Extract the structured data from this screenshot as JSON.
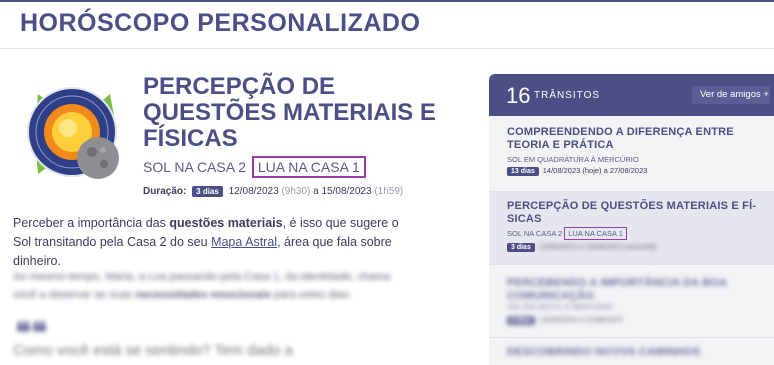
{
  "header": {
    "title": "HORÓSCOPO PERSONALIZADO"
  },
  "article": {
    "title": "PERCEPÇÃO DE QUESTÕES MATERIAIS E FÍSICAS",
    "subtitle_sun": "SOL NA CASA 2",
    "subtitle_moon": "LUA NA CASA 1",
    "duration_label": "Duração:",
    "duration_badge": "3 dias",
    "start_date": "12/08/2023",
    "start_time": "(9h30)",
    "to": "a",
    "end_date": "15/08/2023",
    "end_time": "(1h59)",
    "p1_a": "Perceber a importância das",
    "p1_bold": "questões materiais",
    "p1_b": ", é isso que sugere o Sol transitando pela Casa 2 do seu",
    "p1_link": "Mapa Astral",
    "p1_c": ", área que fala sobre dinheiro.",
    "p2_a": "Ao mesmo tempo, Maria, a Lua passando pela Casa 1, da identidade, chama você a observar as suas",
    "p2_bold": "necessidades emocionais",
    "p2_b": "para estes dias.",
    "quote": "❝❝",
    "blur_heading": "Como você está se sentindo? Tem dado a"
  },
  "sidebar": {
    "count": "16",
    "count_label": "TRÂNSITOS",
    "friends_button": "Ver de amigos +",
    "transits": [
      {
        "title": "COMPREENDENDO A DIFERENÇA ENTRE TEORIA E PRÁTICA",
        "sub": "SOL EM QUADRATURA À MERCÚRIO",
        "badge": "13 dias",
        "dates": "14/08/2023 (hoje) a 27/08/2023"
      },
      {
        "title": "PERCEPÇÃO DE QUESTÕES MATERIAIS E FÍ-SICAS",
        "sub_a": "SOL NA CASA 2",
        "sub_b": "LUA NA CASA 1",
        "badge": "3 dias",
        "dates": "12/08/2023 a 15/08/2023 (amanhã)"
      },
      {
        "title": "PERCEBENDO A IMPORTÂNCIA DA BOA COMUNICAÇÃO",
        "sub": "SOL EM SEXTIL À MERCÚRIO",
        "badge": "8 dias",
        "dates": "13/08/2023 a 21/08/2023"
      },
      {
        "title": "DESCOBRINDO NOVOS CAMINHOS"
      }
    ]
  }
}
